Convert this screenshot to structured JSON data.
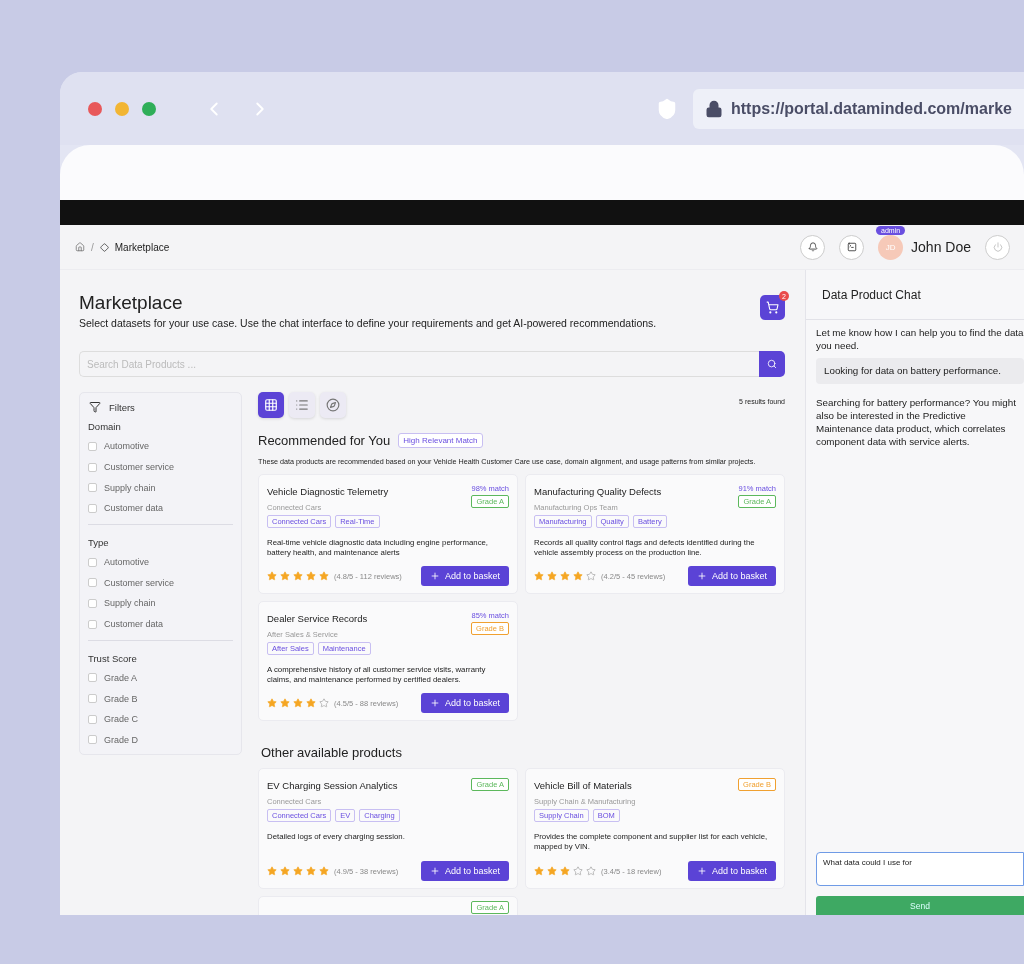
{
  "browser": {
    "url": "https://portal.dataminded.com/marke"
  },
  "breadcrumb": {
    "separator": "/",
    "current": "Marketplace"
  },
  "user": {
    "initials": "JD",
    "name": "John Doe",
    "role": "admin"
  },
  "page": {
    "title": "Marketplace",
    "subtitle": "Select datasets for your use case. Use the chat interface to define your requirements and get AI-powered recommendations."
  },
  "cart": {
    "count": "2"
  },
  "search": {
    "placeholder": "Search Data Products ..."
  },
  "filters": {
    "title": "Filters",
    "groups": [
      {
        "title": "Domain",
        "options": [
          {
            "label": "Automotive",
            "checked": false
          },
          {
            "label": "Customer service",
            "checked": false
          },
          {
            "label": "Supply chain",
            "checked": false
          },
          {
            "label": "Customer data",
            "checked": false
          }
        ]
      },
      {
        "title": "Type",
        "options": [
          {
            "label": "Automotive",
            "checked": false
          },
          {
            "label": "Customer service",
            "checked": false
          },
          {
            "label": "Supply chain",
            "checked": false
          },
          {
            "label": "Customer data",
            "checked": false
          }
        ]
      },
      {
        "title": "Trust Score",
        "options": [
          {
            "label": "Grade A",
            "checked": false
          },
          {
            "label": "Grade B",
            "checked": false
          },
          {
            "label": "Grade C",
            "checked": false
          },
          {
            "label": "Grade D",
            "checked": false
          }
        ]
      }
    ]
  },
  "views": [
    {
      "kind": "grid",
      "selected": true
    },
    {
      "kind": "list",
      "selected": false
    },
    {
      "kind": "explore",
      "selected": false
    }
  ],
  "results_count": "5 results found",
  "recommended": {
    "title": "Recommended for You",
    "badge": "High Relevant Match",
    "description": "These data products are recommended based on your Vehicle Health Customer Care use case, domain alignment, and usage patterns from similar projects.",
    "products": [
      {
        "title": "Vehicle Diagnostic Telemetry",
        "owner": "Connected Cars",
        "match": "98% match",
        "grade": {
          "label": "Grade A",
          "color": "#5cb85c"
        },
        "tags": [
          "Connected Cars",
          "Real-Time"
        ],
        "description": "Real-time vehicle diagnostic data including engine performance, battery health, and maintenance alerts",
        "stars": 5,
        "rating": "(4.8/5 - 112 reviews)",
        "button": "Add to basket"
      },
      {
        "title": "Manufacturing Quality Defects",
        "owner": "Manufacturing Ops Team",
        "match": "91% match",
        "grade": {
          "label": "Grade A",
          "color": "#5cb85c"
        },
        "tags": [
          "Manufacturing",
          "Quality",
          "Battery"
        ],
        "description": "Records all quality control flags and defects identified during the vehicle assembly process on the production line.",
        "stars": 4,
        "rating": "(4.2/5 - 45 reviews)",
        "button": "Add to basket"
      },
      {
        "title": "Dealer Service Records",
        "owner": "After Sales & Service",
        "match": "85% match",
        "grade": {
          "label": "Grade B",
          "color": "#f0a030"
        },
        "tags": [
          "After Sales",
          "Maintenance"
        ],
        "description": "A comprehensive history of all customer service visits, warranty claims, and maintenance performed by certified dealers.",
        "stars": 4,
        "rating": "(4.5/5 - 88 reviews)",
        "button": "Add to basket"
      }
    ]
  },
  "other": {
    "title": "Other available products",
    "products": [
      {
        "title": "EV Charging Session Analytics",
        "owner": "Connected Cars",
        "grade": {
          "label": "Grade A",
          "color": "#5cb85c"
        },
        "tags": [
          "Connected Cars",
          "EV",
          "Charging"
        ],
        "description": "Detailed logs of every charging session.",
        "stars": 5,
        "rating": "(4.9/5 - 38 reviews)",
        "button": "Add to basket"
      },
      {
        "title": "Vehicle Bill of Materials",
        "owner": "Supply Chain & Manufacturing",
        "grade": {
          "label": "Grade B",
          "color": "#f0a030"
        },
        "tags": [
          "Supply Chain",
          "BOM"
        ],
        "description": "Provides the complete component and supplier list for each vehicle, mapped by VIN.",
        "stars": 3,
        "rating": "(3.4/5 - 18 review)",
        "button": "Add to basket"
      },
      {
        "grade": {
          "label": "Grade A",
          "color": "#5cb85c"
        }
      }
    ]
  },
  "chat": {
    "title": "Data Product Chat",
    "messages": [
      {
        "kind": "assistant",
        "text": "Let me know how I can help you to find the data you need."
      },
      {
        "kind": "user",
        "text": "Looking for data on battery performance."
      },
      {
        "kind": "assistant",
        "text": "Searching for battery performance? You might also be interested in the Predictive Maintenance data product, which correlates component data with service alerts."
      }
    ],
    "input": {
      "value": "What data could I use for "
    },
    "send": "Send"
  }
}
